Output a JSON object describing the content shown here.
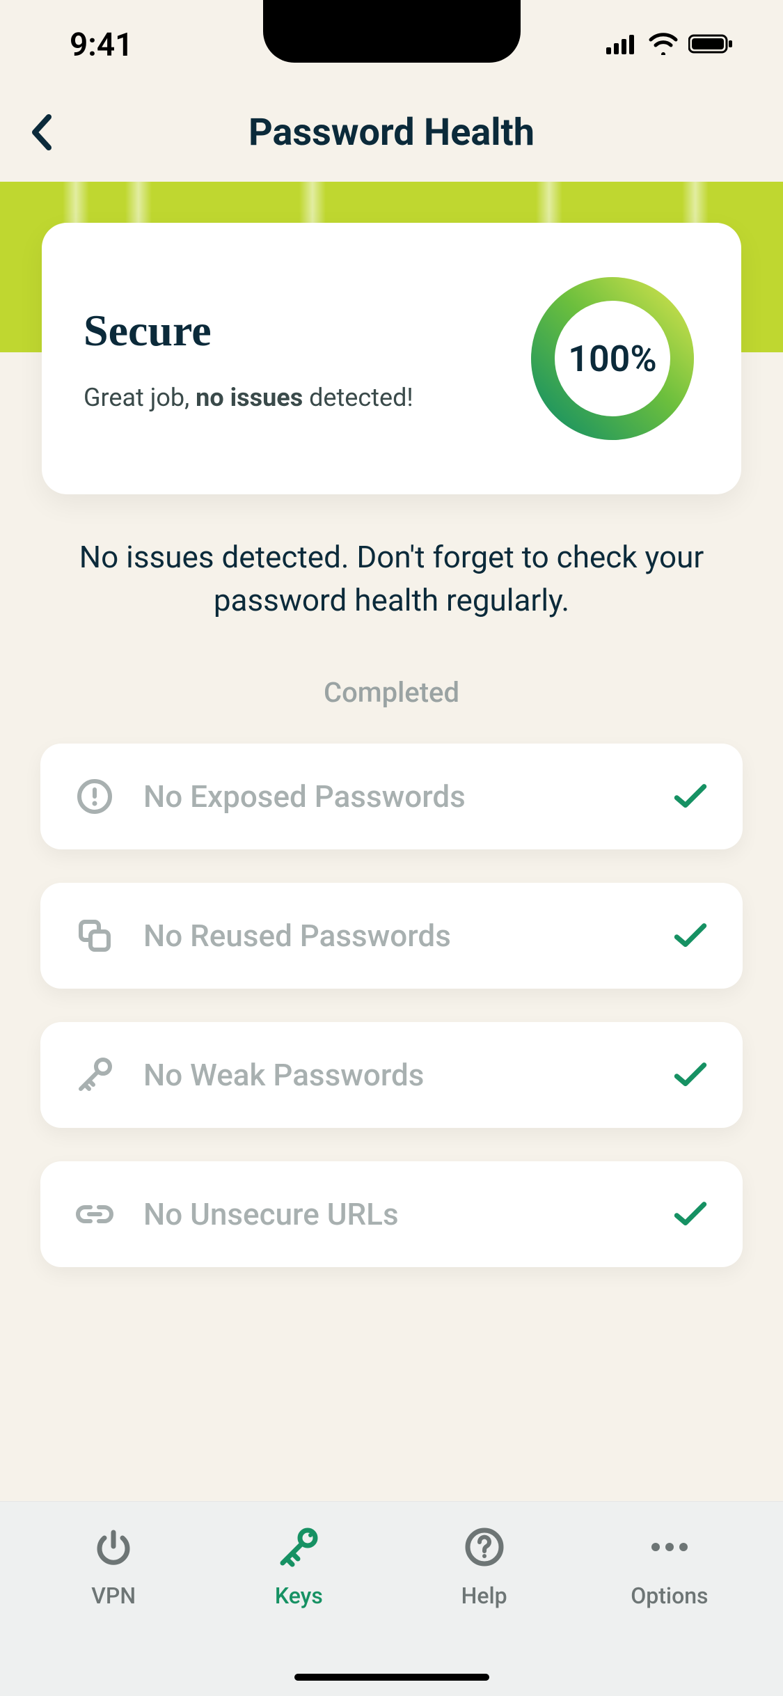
{
  "status_bar": {
    "time": "9:41"
  },
  "header": {
    "title": "Password Health"
  },
  "secure_card": {
    "title": "Secure",
    "subtitle_prefix": "Great job, ",
    "subtitle_bold": "no issues",
    "subtitle_suffix": " detected!",
    "score_text": "100%"
  },
  "chart_data": {
    "type": "pie",
    "title": "Password Health Score",
    "series": [
      {
        "name": "Secure",
        "values": [
          100
        ]
      }
    ],
    "ylim": [
      0,
      100
    ]
  },
  "message": "No issues detected. Don't forget to check your password health regularly.",
  "completed_label": "Completed",
  "check_items": [
    {
      "icon": "alert-icon",
      "label": "No Exposed Passwords"
    },
    {
      "icon": "copy-icon",
      "label": "No Reused Passwords"
    },
    {
      "icon": "key-icon",
      "label": "No Weak Passwords"
    },
    {
      "icon": "link-icon",
      "label": "No Unsecure URLs"
    }
  ],
  "tabs": [
    {
      "id": "vpn",
      "label": "VPN",
      "active": false
    },
    {
      "id": "keys",
      "label": "Keys",
      "active": true
    },
    {
      "id": "help",
      "label": "Help",
      "active": false
    },
    {
      "id": "options",
      "label": "Options",
      "active": false
    }
  ],
  "colors": {
    "accent_green": "#169163",
    "lime": "#bfd730",
    "text_dark": "#0b2a3a",
    "text_muted": "#a8b0b0"
  }
}
